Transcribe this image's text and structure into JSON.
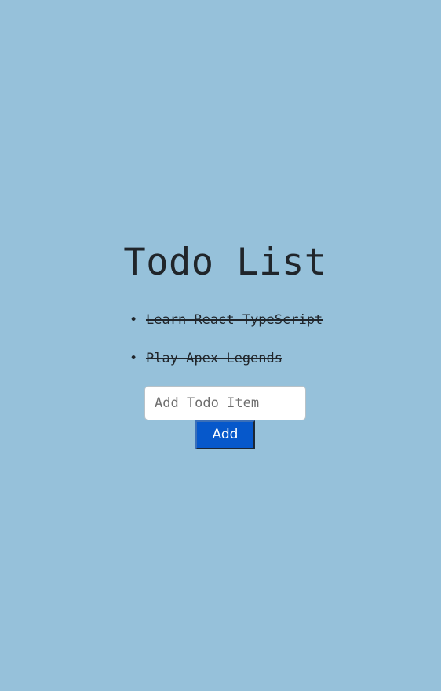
{
  "page": {
    "title": "Todo List",
    "background_color": "#96c1da"
  },
  "todos": [
    {
      "text": "Learn React TypeScript",
      "completed": true
    },
    {
      "text": "Play Apex Legends",
      "completed": true
    }
  ],
  "form": {
    "input_placeholder": "Add Todo Item",
    "input_value": "",
    "add_label": "Add",
    "add_button_color": "#0658cb"
  }
}
